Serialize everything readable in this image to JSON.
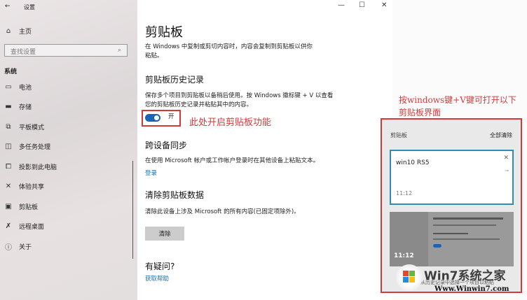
{
  "window": {
    "title": "设置",
    "controls": {
      "minimize": "—",
      "maximize": "☐",
      "close": "✕"
    }
  },
  "sidebar": {
    "home": "主页",
    "search_placeholder": "查找设置",
    "section": "系统",
    "items": [
      {
        "label": "电池",
        "icon": "battery-icon"
      },
      {
        "label": "存储",
        "icon": "storage-icon"
      },
      {
        "label": "平板模式",
        "icon": "tablet-icon"
      },
      {
        "label": "多任务处理",
        "icon": "multitask-icon"
      },
      {
        "label": "投影到此电脑",
        "icon": "project-icon"
      },
      {
        "label": "体验共享",
        "icon": "share-icon"
      },
      {
        "label": "剪贴板",
        "icon": "clipboard-icon"
      },
      {
        "label": "远程桌面",
        "icon": "remote-icon"
      },
      {
        "label": "关于",
        "icon": "info-icon"
      }
    ]
  },
  "main": {
    "title": "剪贴板",
    "intro": "在 Windows 中复制或剪切内容时，内容会复制到剪贴板以供你粘贴。",
    "history": {
      "heading": "剪贴板历史记录",
      "desc": "保存多个项目到剪贴板以备稍后使用。按 Windows 徽标键 + V 以查看您的剪贴板历史记录并粘贴其中的内容。",
      "toggle_label": "开",
      "toggle_on": true
    },
    "sync": {
      "heading": "跨设备同步",
      "desc": "在使用 Microsoft 帐户或工作帐户登录时在其他设备上粘贴文本。",
      "link": "登录"
    },
    "clear": {
      "heading": "清除剪贴板数据",
      "desc": "清除此设备上涉及 Microsoft 的所有内容(已固定项除外)。",
      "button": "清除"
    },
    "help": {
      "heading": "有疑问?",
      "link": "获取帮助"
    }
  },
  "annotations": {
    "toggle_note": "此处开启剪贴板功能",
    "panel_note_1": "按windows键+V键可打开以下",
    "panel_note_2": "剪贴板界面"
  },
  "panel": {
    "title": "剪贴板",
    "clear_all": "全部清除",
    "items": [
      {
        "text": "win10 RS5",
        "time": "11:12"
      },
      {
        "text": "",
        "time": "11:12"
      }
    ],
    "footer": "从历史记录中选择一个项目以粘贴"
  },
  "watermark": {
    "brand": "Win7系统之家",
    "url": "Www.Winwin7.com"
  }
}
